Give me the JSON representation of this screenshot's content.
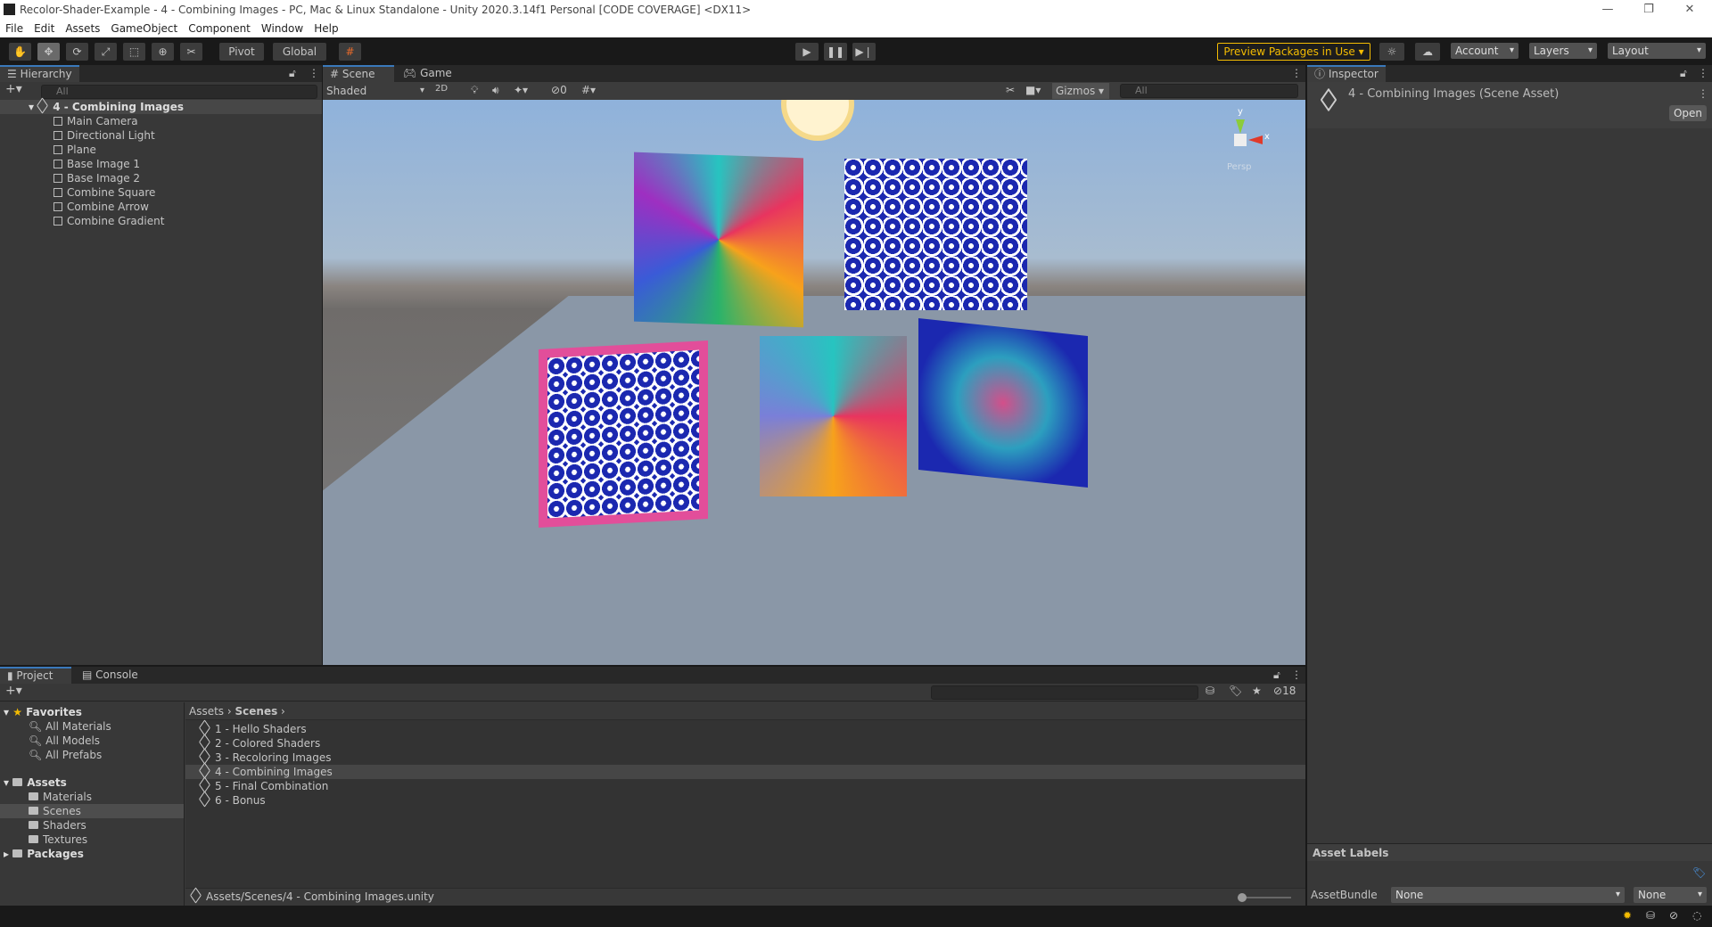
{
  "window": {
    "title": "Recolor-Shader-Example - 4 - Combining Images - PC, Mac & Linux Standalone - Unity 2020.3.14f1 Personal [CODE COVERAGE] <DX11>",
    "minimize": "—",
    "restore": "❐",
    "close": "✕"
  },
  "menu": [
    "File",
    "Edit",
    "Assets",
    "GameObject",
    "Component",
    "Window",
    "Help"
  ],
  "toolbar": {
    "pivot": "Pivot",
    "global": "Global",
    "preview_packages": "Preview Packages in Use",
    "account": "Account",
    "layers": "Layers",
    "layout": "Layout",
    "accent": "#f4bc02"
  },
  "hierarchy": {
    "tab": "Hierarchy",
    "search_placeholder": "All",
    "scene": "4 - Combining Images",
    "items": [
      "Main Camera",
      "Directional Light",
      "Plane",
      "Base Image 1",
      "Base Image 2",
      "Combine Square",
      "Combine Arrow",
      "Combine Gradient"
    ]
  },
  "scene": {
    "tabs": [
      "Scene",
      "Game"
    ],
    "shading": "Shaded",
    "mode_2d": "2D",
    "hidden_count": "0",
    "gizmos": "Gizmos",
    "search_placeholder": "All",
    "axis_y": "y",
    "axis_x": "x",
    "view_label": "Persp"
  },
  "inspector": {
    "tab": "Inspector",
    "asset_title": "4 - Combining Images (Scene Asset)",
    "open": "Open",
    "asset_labels": "Asset Labels",
    "assetbundle_label": "AssetBundle",
    "assetbundle_value": "None",
    "variant_value": "None"
  },
  "project": {
    "tabs": [
      "Project",
      "Console"
    ],
    "favorites": "Favorites",
    "favorite_items": [
      "All Materials",
      "All Models",
      "All Prefabs"
    ],
    "assets": "Assets",
    "asset_folders": [
      "Materials",
      "Scenes",
      "Shaders",
      "Textures"
    ],
    "packages": "Packages",
    "breadcrumb": [
      "Assets",
      "Scenes"
    ],
    "files": [
      "1 - Hello Shaders",
      "2 - Colored Shaders",
      "3 - Recoloring Images",
      "4 - Combining Images",
      "5 - Final Combination",
      "6 - Bonus"
    ],
    "selected_file": "4 - Combining Images",
    "selected_folder": "Scenes",
    "hidden_count": "18",
    "path": "Assets/Scenes/4 - Combining Images.unity"
  }
}
